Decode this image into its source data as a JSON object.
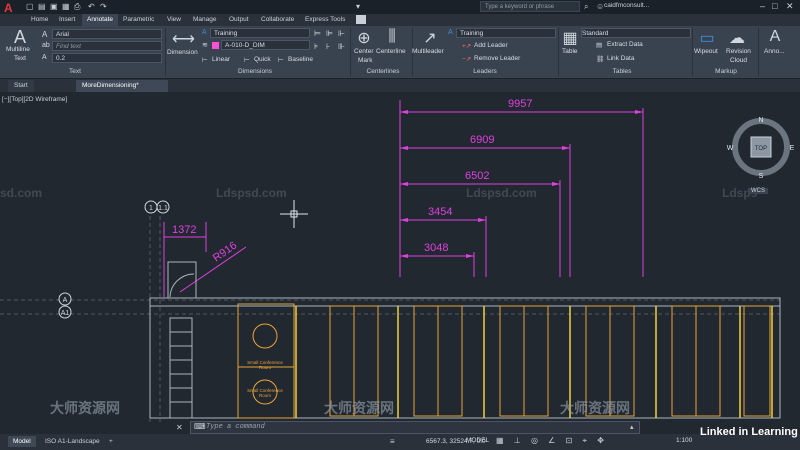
{
  "app": {
    "logo": "A",
    "search_placeholder": "Type a keyword or phrase",
    "user": "caidfmconsult...",
    "win_min": "–",
    "win_max": "□",
    "win_close": "✕"
  },
  "menu_tabs": [
    "Home",
    "Insert",
    "Annotate",
    "Parametric",
    "View",
    "Manage",
    "Output",
    "Collaborate",
    "Express Tools"
  ],
  "ribbon": {
    "text_panel": {
      "multiline_label_1": "Multiline",
      "multiline_label_2": "Text",
      "font": "Arial",
      "find_placeholder": "Find text",
      "height": "0.2",
      "title": "Text"
    },
    "dimensions_panel": {
      "dimension_label": "Dimension",
      "dimstyle": "Training",
      "layer": "A-010-D_DIM",
      "linear": "Linear",
      "quick": "Quick",
      "baseline": "Baseline",
      "title": "Dimensions"
    },
    "centerlines_panel": {
      "center_mark_1": "Center",
      "center_mark_2": "Mark",
      "centerline": "Centerline",
      "title": "Centerlines"
    },
    "leaders_panel": {
      "multileader": "Multileader",
      "style": "Training",
      "add_leader": "Add Leader",
      "remove_leader": "Remove Leader",
      "title": "Leaders"
    },
    "tables_panel": {
      "table": "Table",
      "style": "Standard",
      "extract_data": "Extract Data",
      "link_data": "Link Data",
      "title": "Tables"
    },
    "markup_panel": {
      "wipeout": "Wipeout",
      "revision_cloud_1": "Revision",
      "revision_cloud_2": "Cloud",
      "title": "Markup"
    },
    "anno_label": "Anno..."
  },
  "file_tabs": [
    "Start",
    "MoreDimensioning*"
  ],
  "viewport_label": "[−][Top][2D Wireframe]",
  "viewcube": {
    "top": "TOP",
    "n": "N",
    "s": "S",
    "e": "E",
    "w": "W",
    "wcs": "WCS"
  },
  "dimensions": {
    "d1": "9957",
    "d2": "6909",
    "d3": "6502",
    "d4": "3454",
    "d5": "3048",
    "d6": "1372",
    "radius": "R916"
  },
  "grid_bubbles": {
    "one": "1",
    "one1": "1.1",
    "a": "A",
    "a1": "A1"
  },
  "rooms": {
    "room1_line1": "Small Conference",
    "room1_line2": "Room",
    "room2_line1": "Small Conference",
    "room2_line2": "Room"
  },
  "watermarks": [
    "sd.com",
    "Ldspsd.com",
    "Ldspsd.com",
    "Ldsps",
    "Ldspsd.com",
    "大师资源网",
    "大师资源网",
    "大师资源网"
  ],
  "command_line": {
    "placeholder": "Type a command",
    "prompt_icon": "⌨"
  },
  "status_bar": {
    "layout_tabs": [
      "Model",
      "ISO A1-Landscape"
    ],
    "add_tab": "+",
    "coordinates": "6567.3, 32524.7, 0.0",
    "model": "MODEL",
    "scale": "1:100",
    "brand": "Linked in Learning"
  },
  "colors": {
    "dimension": "#e040e0",
    "accent_blue": "#3b8fd8",
    "drawing_bg": "#212830",
    "furniture": "#e8a33a"
  }
}
